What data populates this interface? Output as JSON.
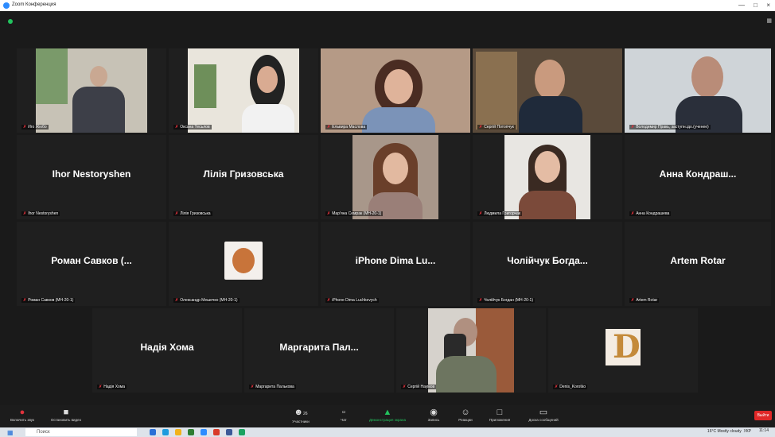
{
  "window": {
    "title": "Zoom Конференция"
  },
  "row1": [
    {
      "label": "Иго Жюбо"
    },
    {
      "label": "Оксана Тесьлов"
    },
    {
      "label": "Ельвира Маслова"
    },
    {
      "label": "Сергій Потопчук"
    },
    {
      "label": "Володимир Пракь, заступн.ідо.(ученее)"
    }
  ],
  "row2": [
    {
      "name": "Ihor Nestoryshen",
      "label": "Ihor Nestoryshen"
    },
    {
      "name": "Лілія Гризовська",
      "label": "Лілія Гризовська"
    },
    {
      "name": "",
      "label": "Мар'яна Семрак (МН-20-1)"
    },
    {
      "name": "",
      "label": "Людмила Григорчак"
    },
    {
      "name": "Анна Кондраш...",
      "label": "Анна Кондрашева"
    }
  ],
  "row3": [
    {
      "name": "Роман Савков (...",
      "label": "Роман Савков (МН-20-1)"
    },
    {
      "name": "",
      "label": "Олександр Мешечко (МН-20-1)"
    },
    {
      "name": "iPhone Dima Lu...",
      "label": "iPhone Dima Luchkevych"
    },
    {
      "name": "Чолійчук Богда...",
      "label": "Чолійчук Богдан (МН-20-1)"
    },
    {
      "name": "Artem Rotar",
      "label": "Artem Rotar"
    }
  ],
  "row4": [
    {
      "name": "Надія Хома",
      "label": "Надія Хома"
    },
    {
      "name": "Маргарита Пал...",
      "label": "Маргарита Палькова"
    },
    {
      "name": "",
      "label": "Сергій Наумов"
    },
    {
      "name": "",
      "label": "Denis_Korotko",
      "avatar_letter": "D"
    }
  ],
  "toolbar": {
    "unmute": "Включить звук",
    "start_video": "Остановить видео",
    "participants": "Участники",
    "participants_count": "26",
    "chat": "Чат",
    "share": "Демонстрация экрана",
    "record": "Запись",
    "reactions": "Реакции",
    "apps": "Приложения",
    "whiteboard": "Доска сообщений",
    "end": "Выйти"
  },
  "taskbar": {
    "search_placeholder": "Поиск",
    "weather": "16°C Mostly cloudy",
    "lang": "УКР",
    "time": "11:14",
    "date": "14.10.2021"
  },
  "colors": {
    "accent": "#2d8cff",
    "active_speaker": "#a8d84a",
    "mic_muted": "#e0323c",
    "end": "#e02828"
  }
}
